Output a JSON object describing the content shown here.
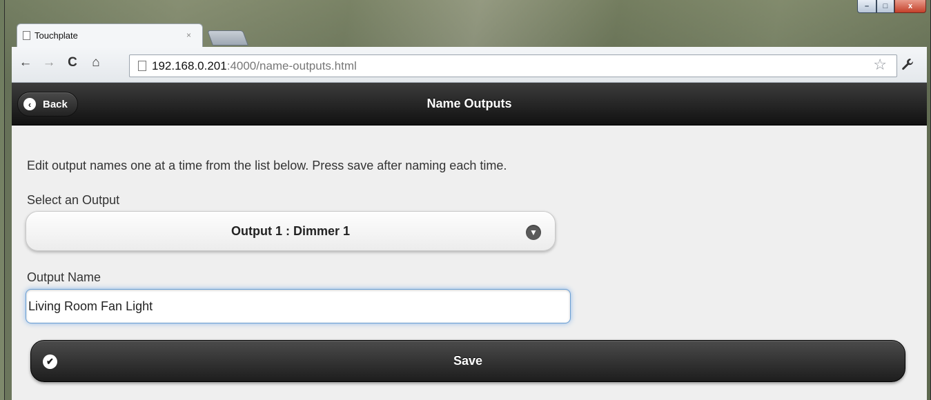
{
  "browser": {
    "tab_title": "Touchplate",
    "tab_close": "×",
    "url_host": "192.168.0.201",
    "url_path": ":4000/name-outputs.html",
    "nav": {
      "back": "←",
      "forward": "→",
      "reload": "C",
      "home": "⌂"
    },
    "star": "☆",
    "wrench": "🔧"
  },
  "window_controls": {
    "minimize": "–",
    "maximize": "□",
    "close": "x"
  },
  "header": {
    "back_label": "Back",
    "title": "Name Outputs"
  },
  "form": {
    "instructions": "Edit output names one at a time from the list below. Press save after naming each time.",
    "select_label": "Select an Output",
    "select_value": "Output 1 : Dimmer 1",
    "name_label": "Output Name",
    "name_value": "Living Room Fan Light",
    "save_label": "Save"
  },
  "icons": {
    "back": "chevron-left-icon",
    "select": "chevron-down-icon",
    "save": "check-icon"
  }
}
